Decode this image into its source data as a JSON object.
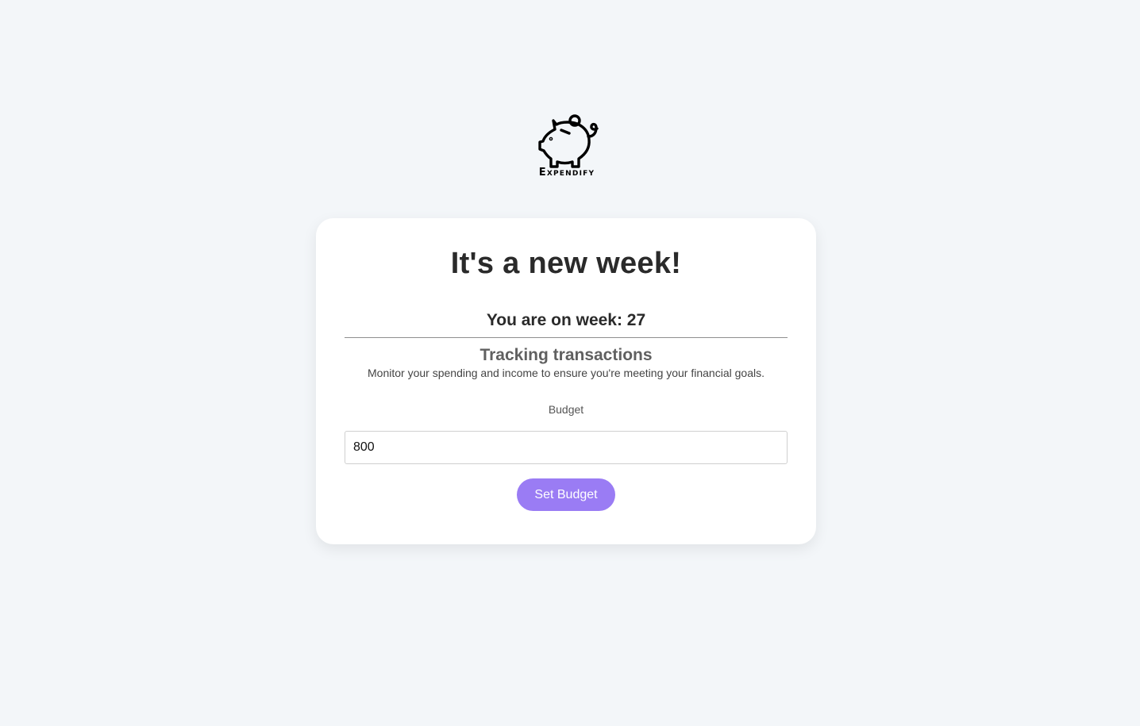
{
  "brand": {
    "name": "Expendify",
    "logo_icon": "piggy-bank-icon"
  },
  "card": {
    "title": "It's a new week!",
    "week_text": "You are on week: 27",
    "section_title": "Tracking transactions",
    "section_description": "Monitor your spending and income to ensure you're meeting your financial goals.",
    "budget_label": "Budget",
    "budget_value": "800",
    "set_button_label": "Set Budget"
  },
  "colors": {
    "background": "#f3f6f9",
    "card": "#ffffff",
    "accent": "#9a7cf4",
    "text_dark": "#2a2a2a"
  }
}
